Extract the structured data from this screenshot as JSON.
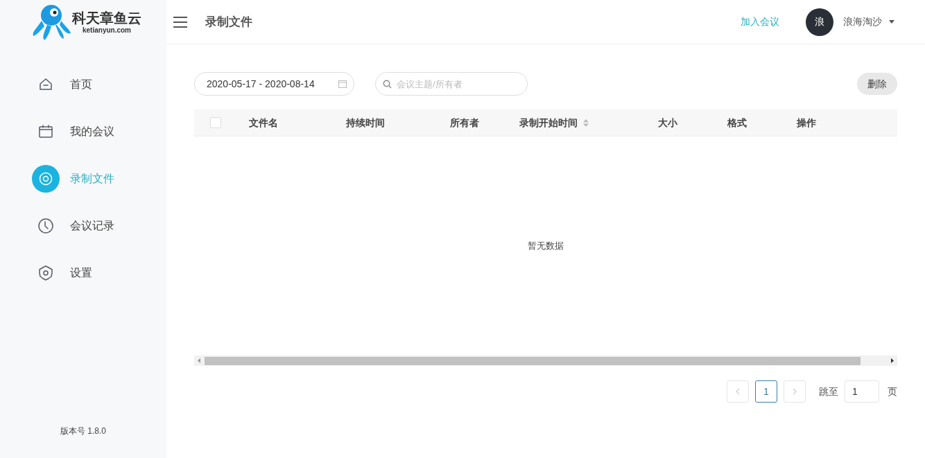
{
  "logo": {
    "name": "科天章鱼云",
    "domain": "ketianyun.com"
  },
  "sidebar": {
    "items": [
      {
        "label": "首页",
        "selected": false
      },
      {
        "label": "我的会议",
        "selected": false
      },
      {
        "label": "录制文件",
        "selected": true
      },
      {
        "label": "会议记录",
        "selected": false
      },
      {
        "label": "设置",
        "selected": false
      }
    ],
    "version": "版本号 1.8.0"
  },
  "header": {
    "title": "录制文件",
    "join_link": "加入会议",
    "avatar": "浪",
    "user": "浪海淘沙"
  },
  "toolbar": {
    "date_range": "2020-05-17 - 2020-08-14",
    "search": {
      "placeholder": "会议主题/所有者"
    },
    "delete_button": "删除"
  },
  "table": {
    "select_all": {
      "checked": false
    },
    "columns": [
      {
        "label": "文件名",
        "sortable": false
      },
      {
        "label": "持续时间",
        "sortable": false
      },
      {
        "label": "所有者",
        "sortable": false
      },
      {
        "label": "录制开始时间",
        "sortable": true
      },
      {
        "label": "大小",
        "sortable": false
      },
      {
        "label": "格式",
        "sortable": false
      },
      {
        "label": "操作",
        "sortable": false
      }
    ],
    "empty_text": "暂无数据"
  },
  "pagination": {
    "prev": {
      "disabled": true
    },
    "pages": [
      {
        "label": "1",
        "selected": true
      }
    ],
    "next": {
      "disabled": true
    },
    "jump_label": "跳至",
    "jump_value": "1",
    "page_suffix": "页"
  }
}
